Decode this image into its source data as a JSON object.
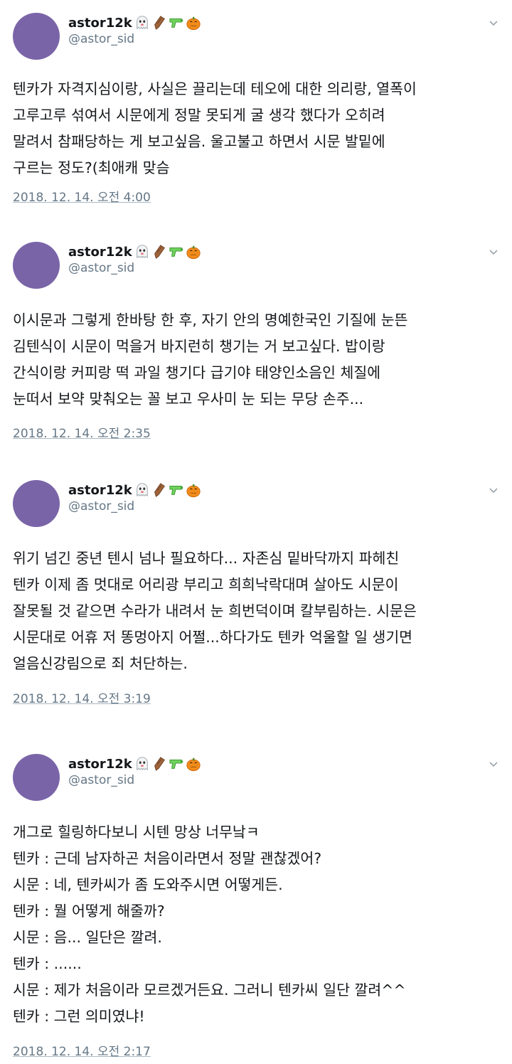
{
  "tweets": [
    {
      "display_name": "astor12k",
      "handle": "@astor_sid",
      "emoji_icons": [
        "ghost-icon",
        "coffin-icon",
        "water-pistol-icon",
        "jack-o-lantern-icon"
      ],
      "lines": [
        "텐카가 자격지심이랑, 사실은 끌리는데 테오에 대한 의리랑, 열폭이",
        "고루고루 섞여서 시문에게 정말 못되게 굴 생각 했다가 오히려",
        "말려서 참패당하는 게 보고싶음. 울고불고 하면서 시문 발밑에",
        "구르는 정도?(최애캐 맞슴"
      ],
      "timestamp": "2018. 12. 14. 오전 4:00"
    },
    {
      "display_name": "astor12k",
      "handle": "@astor_sid",
      "emoji_icons": [
        "ghost-icon",
        "coffin-icon",
        "water-pistol-icon",
        "jack-o-lantern-icon"
      ],
      "lines": [
        "이시문과 그렇게 한바탕 한 후, 자기 안의 명예한국인 기질에 눈뜬",
        "김텐식이 시문이 먹을거 바지런히 챙기는 거 보고싶다. 밥이랑",
        "간식이랑 커피랑 떡 과일 챙기다 급기야 태양인소음인 체질에",
        "눈떠서 보약 맞춰오는 꼴 보고 우사미 눈 되는 무당 손주..."
      ],
      "timestamp": "2018. 12. 14. 오전 2:35"
    },
    {
      "display_name": "astor12k",
      "handle": "@astor_sid",
      "emoji_icons": [
        "ghost-icon",
        "coffin-icon",
        "water-pistol-icon",
        "jack-o-lantern-icon"
      ],
      "lines": [
        "위기 넘긴 중년 텐시 넘나 필요하다... 자존심 밑바닥까지 파헤친",
        "텐카 이제 좀 멋대로 어리광 부리고 희희낙락대며 살아도 시문이",
        "잘못될 것 같으면 수라가 내려서 눈 희번덕이며 칼부림하는. 시문은",
        "시문대로 어휴 저 똥멍아지 어쩔...하다가도 텐카 억울할 일 생기면",
        "얼음신강림으로 죄 처단하는."
      ],
      "timestamp": "2018. 12. 14. 오전 3:19"
    },
    {
      "display_name": "astor12k",
      "handle": "@astor_sid",
      "emoji_icons": [
        "ghost-icon",
        "coffin-icon",
        "water-pistol-icon",
        "jack-o-lantern-icon"
      ],
      "lines": [
        "개그로 힐링하다보니 시텐 망상 너무낰ㅋ",
        "텐카 : 근데 남자하곤 처음이라면서 정말 괜찮겠어?",
        "시문 : 네, 텐카씨가 좀 도와주시면 어떻게든.",
        "텐카 : 뭘 어떻게 해줄까?",
        "시문 : 음... 일단은 깔려.",
        "텐카 : ......",
        "시문 : 제가 처음이라 모르겠거든요. 그러니 텐카씨 일단 깔려^^",
        "텐카 : 그런 의미였냐!"
      ],
      "timestamp": "2018. 12. 14. 오전 2:17"
    }
  ]
}
